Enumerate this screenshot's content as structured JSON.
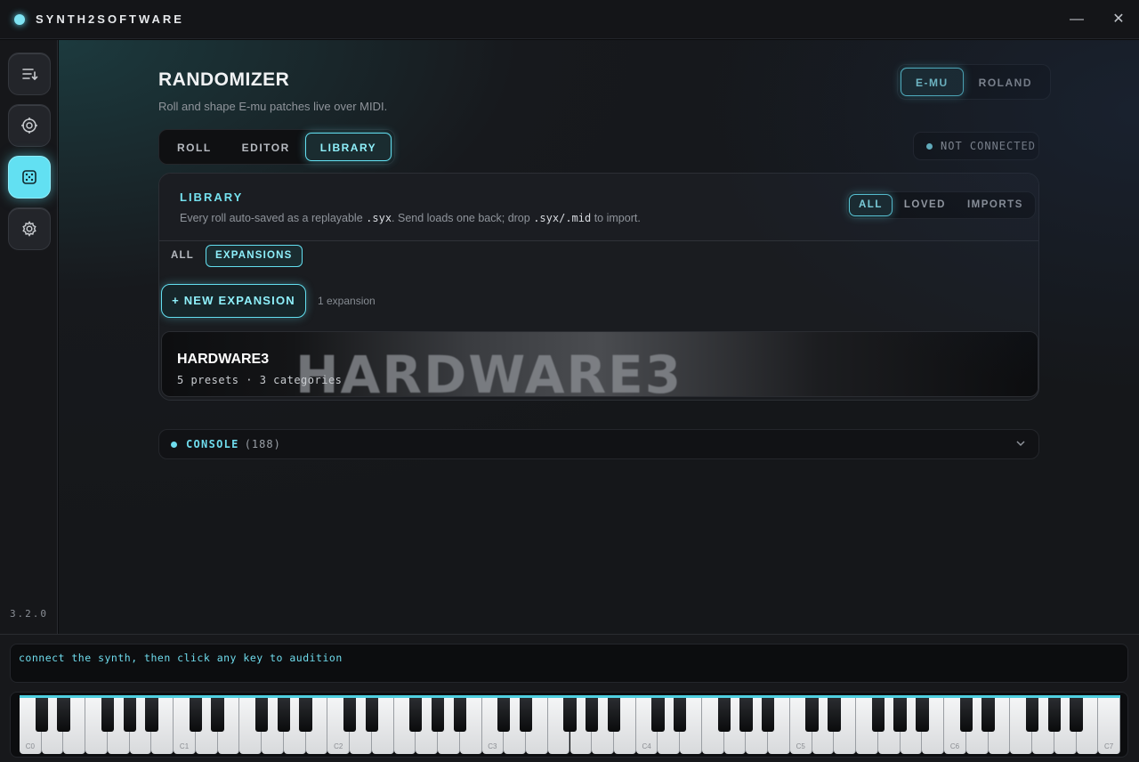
{
  "app": {
    "title": "SYNTH2SOFTWARE",
    "version": "3.2.0",
    "minimize_glyph": "—",
    "close_glyph": "✕"
  },
  "sidebar": {
    "items": [
      {
        "name": "playlist-icon",
        "active": false
      },
      {
        "name": "target-icon",
        "active": false
      },
      {
        "name": "dice-icon",
        "active": true
      },
      {
        "name": "gear-icon",
        "active": false
      }
    ]
  },
  "header": {
    "title": "RANDOMIZER",
    "subtitle": "Roll and shape E-mu patches live over MIDI.",
    "brand_tabs": [
      {
        "label": "E-MU",
        "active": true
      },
      {
        "label": "ROLAND",
        "active": false
      }
    ],
    "mode_tabs": [
      {
        "label": "ROLL",
        "active": false
      },
      {
        "label": "EDITOR",
        "active": false
      },
      {
        "label": "LIBRARY",
        "active": true
      }
    ],
    "status": "NOT CONNECTED"
  },
  "library": {
    "title": "LIBRARY",
    "desc_parts": [
      "Every roll auto-saved as a replayable ",
      ".syx",
      ". Send loads one back; drop ",
      ".syx",
      "/",
      ".mid",
      " to import."
    ],
    "filters": [
      {
        "label": "ALL",
        "active": true
      },
      {
        "label": "LOVED",
        "active": false
      },
      {
        "label": "IMPORTS",
        "active": false
      }
    ],
    "sub_tabs": [
      {
        "label": "ALL",
        "active": false
      },
      {
        "label": "EXPANSIONS",
        "active": true
      }
    ],
    "new_button": "+ NEW EXPANSION",
    "count": "1 expansion",
    "expansions": [
      {
        "name": "HARDWARE3",
        "art_text": "HARDWARE3",
        "meta": "5 presets · 3 categories"
      }
    ]
  },
  "console": {
    "label": "CONSOLE",
    "count": "(188)"
  },
  "keyboard": {
    "message": "connect the synth, then click any key to audition",
    "octave_labels": [
      "C0",
      "C1",
      "C2",
      "C3",
      "C4",
      "C5",
      "C6",
      "C7"
    ],
    "accent": "#63dff0"
  }
}
